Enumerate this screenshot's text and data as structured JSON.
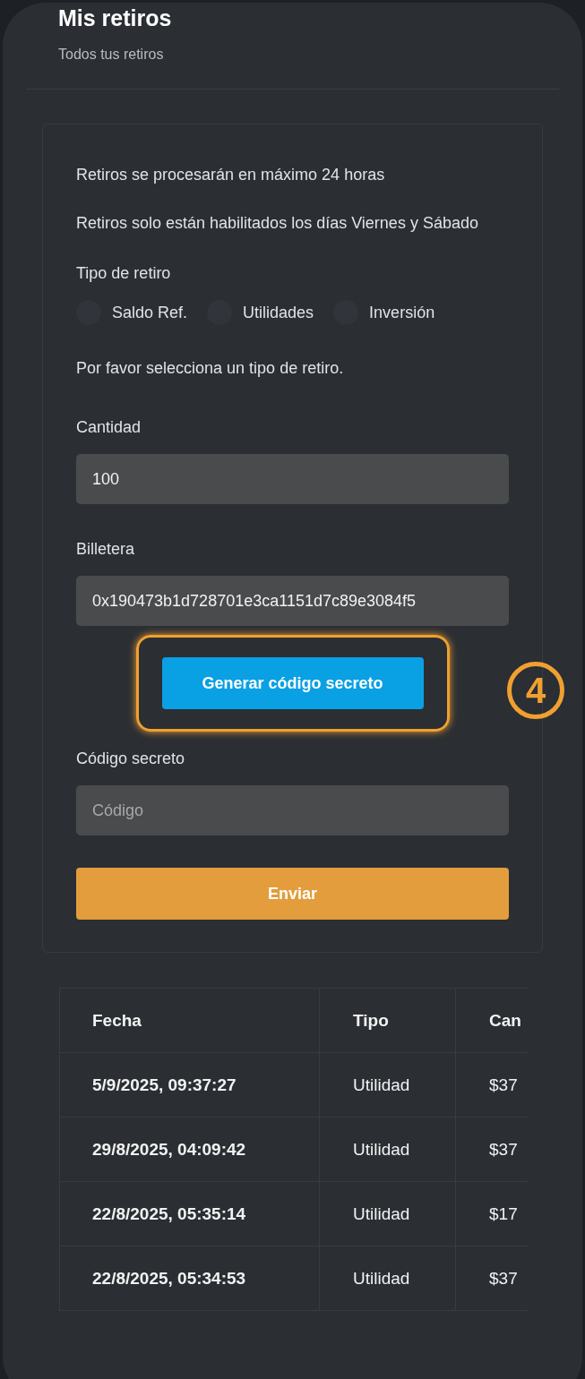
{
  "header": {
    "title": "Mis retiros",
    "subtitle": "Todos tus retiros"
  },
  "notices": [
    "Retiros se procesarán en máximo 24 horas",
    "Retiros solo están habilitados los días Viernes y Sábado"
  ],
  "withdrawal_type": {
    "label": "Tipo de retiro",
    "options": [
      {
        "label": "Saldo Ref.",
        "selected": false
      },
      {
        "label": "Utilidades",
        "selected": false
      },
      {
        "label": "Inversión",
        "selected": false
      }
    ],
    "hint": "Por favor selecciona un tipo de retiro."
  },
  "amount": {
    "label": "Cantidad",
    "value": "100"
  },
  "wallet": {
    "label": "Billetera",
    "value": "0x190473b1d728701e3ca1151d7c89e3084f5"
  },
  "generate_button": {
    "label": "Generar código secreto",
    "highlighted": true,
    "step": "4"
  },
  "secret_code": {
    "label": "Código secreto",
    "placeholder": "Código"
  },
  "submit_button": "Enviar",
  "table": {
    "columns": [
      "Fecha",
      "Tipo",
      "Can"
    ],
    "rows": [
      [
        "5/9/2025, 09:37:27",
        "Utilidad",
        "$37"
      ],
      [
        "29/8/2025, 04:09:42",
        "Utilidad",
        "$37"
      ],
      [
        "22/8/2025, 05:35:14",
        "Utilidad",
        "$17"
      ],
      [
        "22/8/2025, 05:34:53",
        "Utilidad",
        "$37"
      ]
    ]
  }
}
